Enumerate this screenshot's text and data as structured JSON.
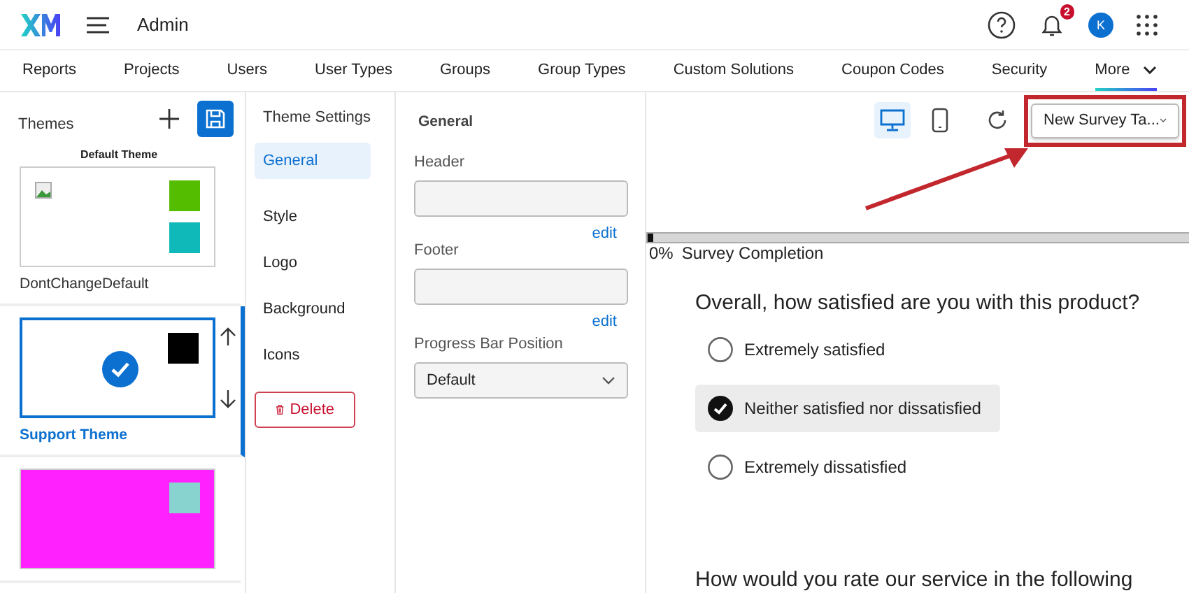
{
  "topbar": {
    "title": "Admin",
    "notifications": "2",
    "avatar": "K"
  },
  "nav": [
    {
      "label": "Reports",
      "selected": false
    },
    {
      "label": "Projects",
      "selected": false
    },
    {
      "label": "Users",
      "selected": false
    },
    {
      "label": "User Types",
      "selected": false
    },
    {
      "label": "Groups",
      "selected": false
    },
    {
      "label": "Group Types",
      "selected": false
    },
    {
      "label": "Custom Solutions",
      "selected": false
    },
    {
      "label": "Coupon Codes",
      "selected": false
    },
    {
      "label": "Security",
      "selected": false
    },
    {
      "label": "More",
      "selected": true
    }
  ],
  "themes": {
    "title": "Themes",
    "items": [
      {
        "heading": "Default Theme",
        "name": "DontChangeDefault",
        "selected": false,
        "color": "#ffffff",
        "broken_image": true,
        "swatches": [
          {
            "color": "#55bd00"
          },
          {
            "color": "#10b9b9"
          }
        ]
      },
      {
        "name": "Support Theme",
        "selected": true,
        "color": "#ffffff",
        "swatches": [
          {
            "color": "#000000"
          }
        ]
      },
      {
        "selected": false,
        "color": "#ff22ff",
        "swatches": [
          {
            "color": "#88d2d0"
          }
        ]
      }
    ]
  },
  "settings_nav": {
    "title": "Theme Settings",
    "items": [
      {
        "label": "General",
        "selected": true
      },
      {
        "label": "Style",
        "selected": false
      },
      {
        "label": "Logo",
        "selected": false
      },
      {
        "label": "Background",
        "selected": false
      },
      {
        "label": "Icons",
        "selected": false
      }
    ],
    "delete": "Delete"
  },
  "general": {
    "title": "General",
    "fields": [
      {
        "label": "Header",
        "link": "edit"
      },
      {
        "label": "Footer",
        "link": "edit"
      }
    ],
    "progress_label": "Progress Bar Position",
    "progress_value": "Default"
  },
  "preview": {
    "devices": [
      {
        "kind": "desktop",
        "selected": true
      },
      {
        "kind": "mobile",
        "selected": false
      }
    ],
    "template": "New Survey Ta...",
    "progress": {
      "level": 0.01,
      "percent": "0%",
      "label": "Survey Completion"
    },
    "question": "Overall, how satisfied are you with this product?",
    "options": [
      {
        "label": "Extremely satisfied",
        "selected": false
      },
      {
        "label": "Neither satisfied nor dissatisfied",
        "selected": true
      },
      {
        "label": "Extremely dissatisfied",
        "selected": false
      }
    ],
    "next_question": "How would you rate our service in the following"
  }
}
